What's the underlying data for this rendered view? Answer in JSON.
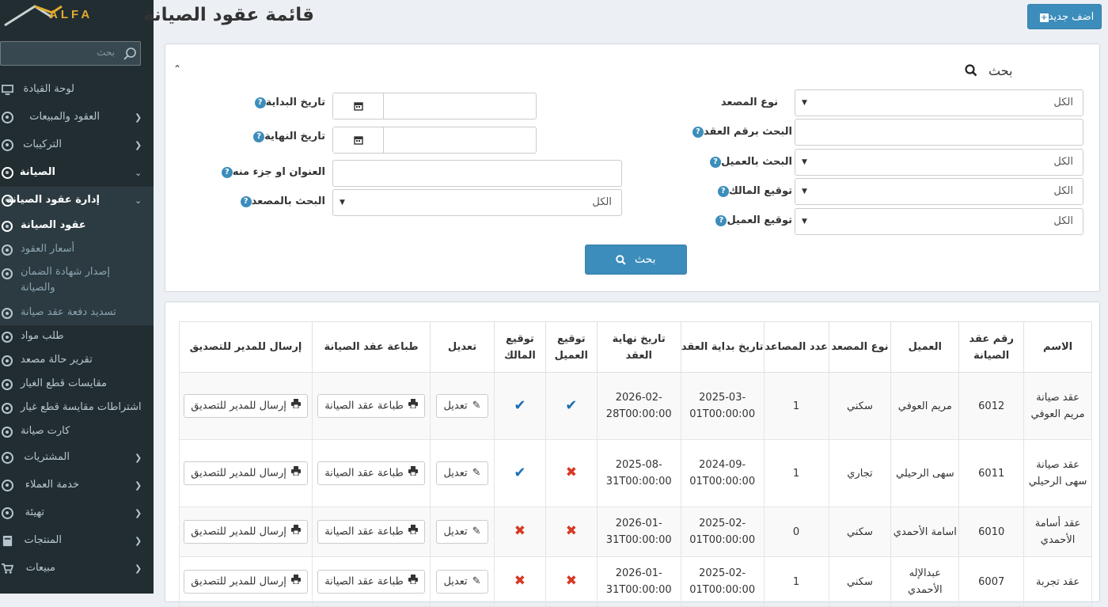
{
  "app": {
    "logo_text": "ALFA"
  },
  "sidebar": {
    "search_placeholder": "بحث",
    "items": [
      {
        "label": "لوحة القيادة"
      },
      {
        "label": "العقود والمبيعات"
      },
      {
        "label": "التركيبات"
      },
      {
        "label": "الصيانة"
      },
      {
        "label": "إدارة عقود الصيانة"
      }
    ],
    "sub_items": [
      {
        "label": "عقود الصيانة"
      },
      {
        "label": "أسعار العقود"
      },
      {
        "label": "إصدار شهادة الضمان والصيانة"
      },
      {
        "label": "تسديد دفعة عقد صيانة"
      }
    ],
    "lower_items": [
      {
        "label": "طلب مواد"
      },
      {
        "label": "تقرير حالة مصعد"
      },
      {
        "label": "مقايسات قطع الغيار"
      },
      {
        "label": "اشتراطات مقايسة قطع غيار"
      },
      {
        "label": "كارت صيانة"
      }
    ],
    "bottom_items": [
      {
        "label": "المشتريات"
      },
      {
        "label": "خدمة العملاء"
      },
      {
        "label": "تهيئة"
      },
      {
        "label": "المنتجات"
      },
      {
        "label": "مبيعات"
      }
    ]
  },
  "header": {
    "title": "قائمة عقود الصيانة",
    "add_label": "اضف جديد"
  },
  "search": {
    "title": "بحث",
    "button_label": "بحث",
    "fields_right": [
      {
        "label": "نوع المصعد",
        "value": "الكل"
      },
      {
        "label": "البحث برقم العقد",
        "value": ""
      },
      {
        "label": "البحث بالعميل",
        "value": "الكل"
      },
      {
        "label": "توقيع المالك",
        "value": "الكل"
      },
      {
        "label": "توقيع العميل",
        "value": "الكل"
      }
    ],
    "fields_left": [
      {
        "label": "تاريخ البداية",
        "value": ""
      },
      {
        "label": "تاريخ النهاية",
        "value": ""
      },
      {
        "label": "العنوان او جزء منه",
        "value": ""
      },
      {
        "label": "البحث بالمصعد",
        "value": "الكل"
      }
    ]
  },
  "table": {
    "headers": [
      "الاسم",
      "رقم عقد الصيانة",
      "العميل",
      "نوع المصعد",
      "عدد المصاعد",
      "تاريخ بداية العقد",
      "تاريخ نهاية العقد",
      "توقيع العميل",
      "توقيع المالك",
      "تعديل",
      "طباعة عقد الصيانة",
      "إرسال للمدير للتصديق"
    ],
    "action_labels": {
      "edit": "تعديل",
      "print": "طباعة عقد الصيانة",
      "send": "إرسال للمدير للتصديق"
    },
    "rows": [
      {
        "name": "عقد صيانة مريم العوفي",
        "number": "6012",
        "client": "مريم العوفي",
        "type": "سكني",
        "count": "1",
        "start": "2025-03-01T00:00:00",
        "end": "2026-02-28T00:00:00",
        "client_sig": true,
        "owner_sig": true
      },
      {
        "name": "عقد صيانة سهى الرحيلي",
        "number": "6011",
        "client": "سهى الرحيلي",
        "type": "تجاري",
        "count": "1",
        "start": "2024-09-01T00:00:00",
        "end": "2025-08-31T00:00:00",
        "client_sig": false,
        "owner_sig": true
      },
      {
        "name": "عقد أسامة الأحمدي",
        "number": "6010",
        "client": "اسامة الأحمدي",
        "type": "سكني",
        "count": "0",
        "start": "2025-02-01T00:00:00",
        "end": "2026-01-31T00:00:00",
        "client_sig": false,
        "owner_sig": false
      },
      {
        "name": "عقد تجربة",
        "number": "6007",
        "client": "عبدالإله الأحمدي",
        "type": "سكني",
        "count": "1",
        "start": "2025-02-01T00:00:00",
        "end": "2026-01-31T00:00:00",
        "client_sig": false,
        "owner_sig": false
      }
    ]
  },
  "colors": {
    "primary": "#3c8dbc",
    "sidebar": "#222d32",
    "check": "#1a6fb5",
    "cross": "#d73925"
  }
}
